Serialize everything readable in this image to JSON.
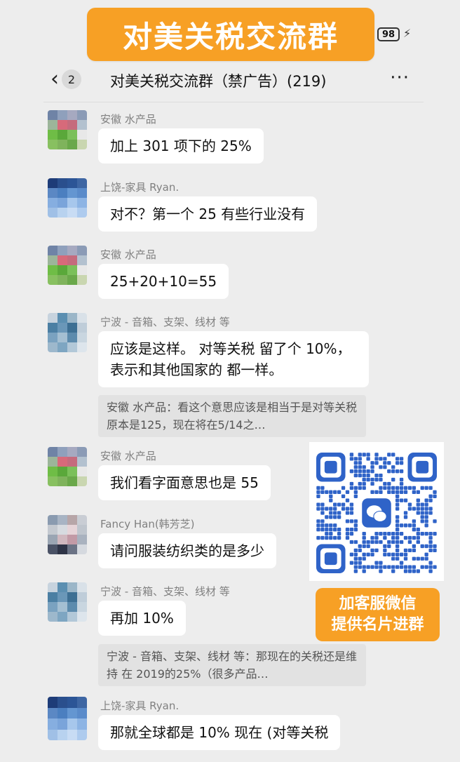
{
  "banner": {
    "title": "对美关税交流群"
  },
  "status": {
    "battery": "98"
  },
  "header": {
    "unread": "2",
    "title": "对美关税交流群（禁广告）(219)",
    "more": "···"
  },
  "messages": [
    {
      "sender": "安徽 水产品",
      "text": "加上 301 项下的 25%",
      "avatar": [
        "#6f83a6",
        "#8fa0bc",
        "#a6a9c0",
        "#8b9bb6",
        "#9cb59a",
        "#d76a7a",
        "#c56b7d",
        "#b3c1cf",
        "#6fbd46",
        "#5aa83a",
        "#7bc05a",
        "#e8e8e8",
        "#88c060",
        "#7fb35c",
        "#6aa84a",
        "#c9d6b0"
      ]
    },
    {
      "sender": "上饶-家具 Ryan.",
      "text": "对不？第一个 25 有些行业没有",
      "avatar": [
        "#1e3c78",
        "#2a4f8d",
        "#2c5596",
        "#3e66a3",
        "#5b88c4",
        "#4b7fc0",
        "#6496d1",
        "#5a8bca",
        "#86aee0",
        "#7aa4da",
        "#a7c7ec",
        "#8db4e4",
        "#a0c0e6",
        "#b8d2ef",
        "#c8dcf4",
        "#aecbee"
      ]
    },
    {
      "sender": "安徽 水产品",
      "text": "25+20+10=55",
      "avatar": [
        "#6f83a6",
        "#8fa0bc",
        "#a6a9c0",
        "#8b9bb6",
        "#9cb59a",
        "#d76a7a",
        "#c56b7d",
        "#b3c1cf",
        "#6fbd46",
        "#5aa83a",
        "#7bc05a",
        "#e8e8e8",
        "#88c060",
        "#7fb35c",
        "#6aa84a",
        "#c9d6b0"
      ]
    },
    {
      "sender": "宁波 - 音箱、支架、线材 等",
      "text": "应该是这样。 对等关税 留了个 10%，表示和其他国家的 都一样。",
      "quote": "安徽 水产品：看这个意思应该是相当于是对等关税原本是125，现在将在5/14之…",
      "avatar": [
        "#c7d3de",
        "#5b8fb1",
        "#9bb6c8",
        "#d9e1e8",
        "#4b7fa3",
        "#6a97b8",
        "#3d6f93",
        "#bfcdd9",
        "#7aa2c0",
        "#a4bfd2",
        "#5c8bad",
        "#c9d6e0",
        "#9db8cc",
        "#7ea6c2",
        "#b2c8d8",
        "#dde5ec"
      ]
    },
    {
      "sender": "安徽 水产品",
      "text": "我们看字面意思也是 55",
      "avatar": [
        "#6f83a6",
        "#8fa0bc",
        "#a6a9c0",
        "#8b9bb6",
        "#9cb59a",
        "#d76a7a",
        "#c56b7d",
        "#b3c1cf",
        "#6fbd46",
        "#5aa83a",
        "#7bc05a",
        "#e8e8e8",
        "#88c060",
        "#7fb35c",
        "#6aa84a",
        "#c9d6b0"
      ]
    },
    {
      "sender": "Fancy Han(韩芳芝)",
      "text": "请问服装纺织类的是多少",
      "avatar": [
        "#8a9bb0",
        "#a8b4c4",
        "#b7a6a8",
        "#c9cdd4",
        "#c4c9d0",
        "#d7dbe0",
        "#e6d4d8",
        "#bfc5cd",
        "#9aa5b3",
        "#d0b8bf",
        "#c29aa6",
        "#a9b2bf",
        "#4a5266",
        "#2e3447",
        "#6b7385",
        "#d5d9df"
      ]
    },
    {
      "sender": "宁波 - 音箱、支架、线材 等",
      "text": "再加 10%",
      "quote": "宁波 - 音箱、支架、线材 等：那现在的关税还是维持 在 2019的25%（很多产品…",
      "avatar": [
        "#c7d3de",
        "#5b8fb1",
        "#9bb6c8",
        "#d9e1e8",
        "#4b7fa3",
        "#6a97b8",
        "#3d6f93",
        "#bfcdd9",
        "#7aa2c0",
        "#a4bfd2",
        "#5c8bad",
        "#c9d6e0",
        "#9db8cc",
        "#7ea6c2",
        "#b2c8d8",
        "#dde5ec"
      ]
    },
    {
      "sender": "上饶-家具 Ryan.",
      "text": "那就全球都是 10% 现在 (对等关税",
      "avatar": [
        "#1e3c78",
        "#2a4f8d",
        "#2c5596",
        "#3e66a3",
        "#5b88c4",
        "#4b7fc0",
        "#6496d1",
        "#5a8bca",
        "#86aee0",
        "#7aa4da",
        "#a7c7ec",
        "#8db4e4",
        "#a0c0e6",
        "#b8d2ef",
        "#c8dcf4",
        "#aecbee"
      ]
    }
  ],
  "promo": {
    "line1": "加客服微信",
    "line2": "提供名片进群"
  },
  "colors": {
    "accent": "#f7a025",
    "background": "#ededed",
    "bubble": "#ffffff",
    "quote": "#e2e2e2",
    "qr": "#2f63c8"
  }
}
